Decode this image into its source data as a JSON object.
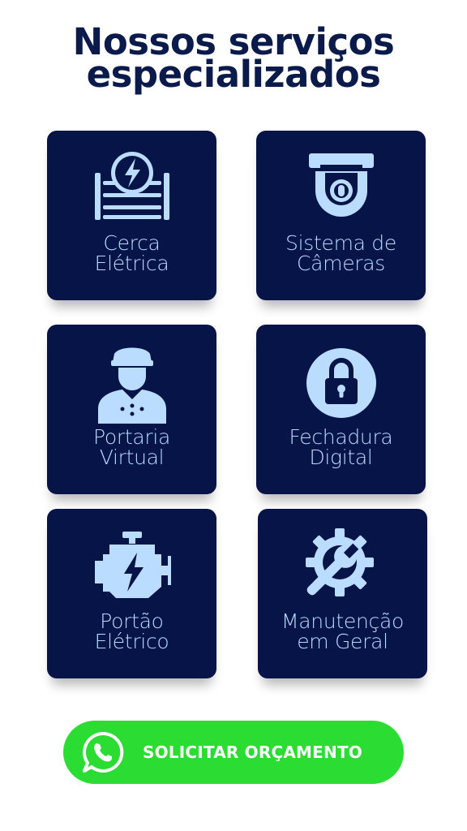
{
  "title": {
    "line1": "Nossos serviços",
    "line2": "especializados"
  },
  "colors": {
    "card_bg": "#061447",
    "accent": "#b9dcff",
    "cta_bg": "#2bdc32",
    "title": "#0a1a4a"
  },
  "services": [
    {
      "line1": "Cerca",
      "line2": "Elétrica",
      "icon": "electric-fence-icon"
    },
    {
      "line1": "Sistema de",
      "line2": "Câmeras",
      "icon": "security-camera-icon"
    },
    {
      "line1": "Portaria",
      "line2": "Virtual",
      "icon": "doorman-icon"
    },
    {
      "line1": "Fechadura",
      "line2": "Digital",
      "icon": "lock-icon"
    },
    {
      "line1": "Portão",
      "line2": "Elétrico",
      "icon": "electric-motor-icon"
    },
    {
      "line1": "Manutenção",
      "line2": "em Geral",
      "icon": "gear-wrench-icon"
    }
  ],
  "cta": {
    "label": "SOLICITAR ORÇAMENTO",
    "icon": "whatsapp-icon"
  }
}
